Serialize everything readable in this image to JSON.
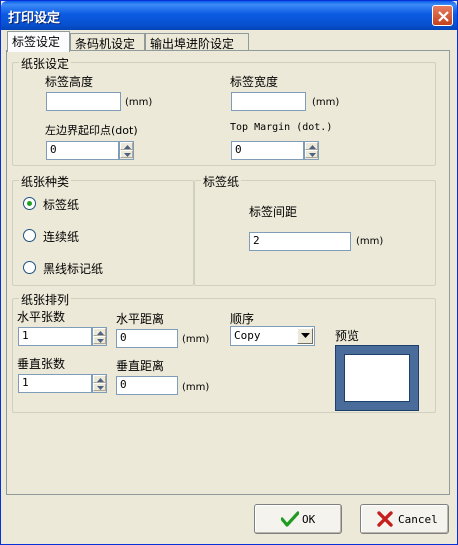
{
  "window": {
    "title": "打印设定"
  },
  "tabs": [
    "标签设定",
    "条码机设定",
    "输出埠进阶设定"
  ],
  "paper_settings": {
    "legend": "纸张设定",
    "height_label": "标签高度",
    "height_value": "",
    "height_unit": "(mm)",
    "width_label": "标签宽度",
    "width_value": "",
    "width_unit": "(mm)",
    "left_margin_label": "左边界起印点(dot)",
    "left_margin_value": "0",
    "top_margin_label": "Top Margin (dot.)",
    "top_margin_value": "0"
  },
  "paper_type": {
    "legend": "纸张种类",
    "options": [
      "标签纸",
      "连续纸",
      "黑线标记纸"
    ],
    "selected": 0
  },
  "label_paper": {
    "legend": "标签纸",
    "gap_label": "标签间距",
    "gap_value": "2",
    "gap_unit": "(mm)"
  },
  "arrangement": {
    "legend": "纸张排列",
    "h_count_label": "水平张数",
    "h_count_value": "1",
    "h_dist_label": "水平距离",
    "h_dist_value": "0",
    "h_dist_unit": "(mm)",
    "order_label": "顺序",
    "order_value": "Copy",
    "v_count_label": "垂直张数",
    "v_count_value": "1",
    "v_dist_label": "垂直距离",
    "v_dist_value": "0",
    "v_dist_unit": "(mm)",
    "preview_label": "预览"
  },
  "buttons": {
    "ok": "OK",
    "cancel": "Cancel"
  },
  "icons": {
    "close": "close-icon",
    "ok": "checkmark-icon",
    "cancel": "x-icon",
    "spin_up": "arrow-up-icon",
    "spin_down": "arrow-down-icon",
    "dropdown": "chevron-down-icon"
  },
  "colors": {
    "titlebar": "#0a5ee8",
    "dialog": "#ece9d8",
    "preview_frame": "#4a6c9b"
  }
}
